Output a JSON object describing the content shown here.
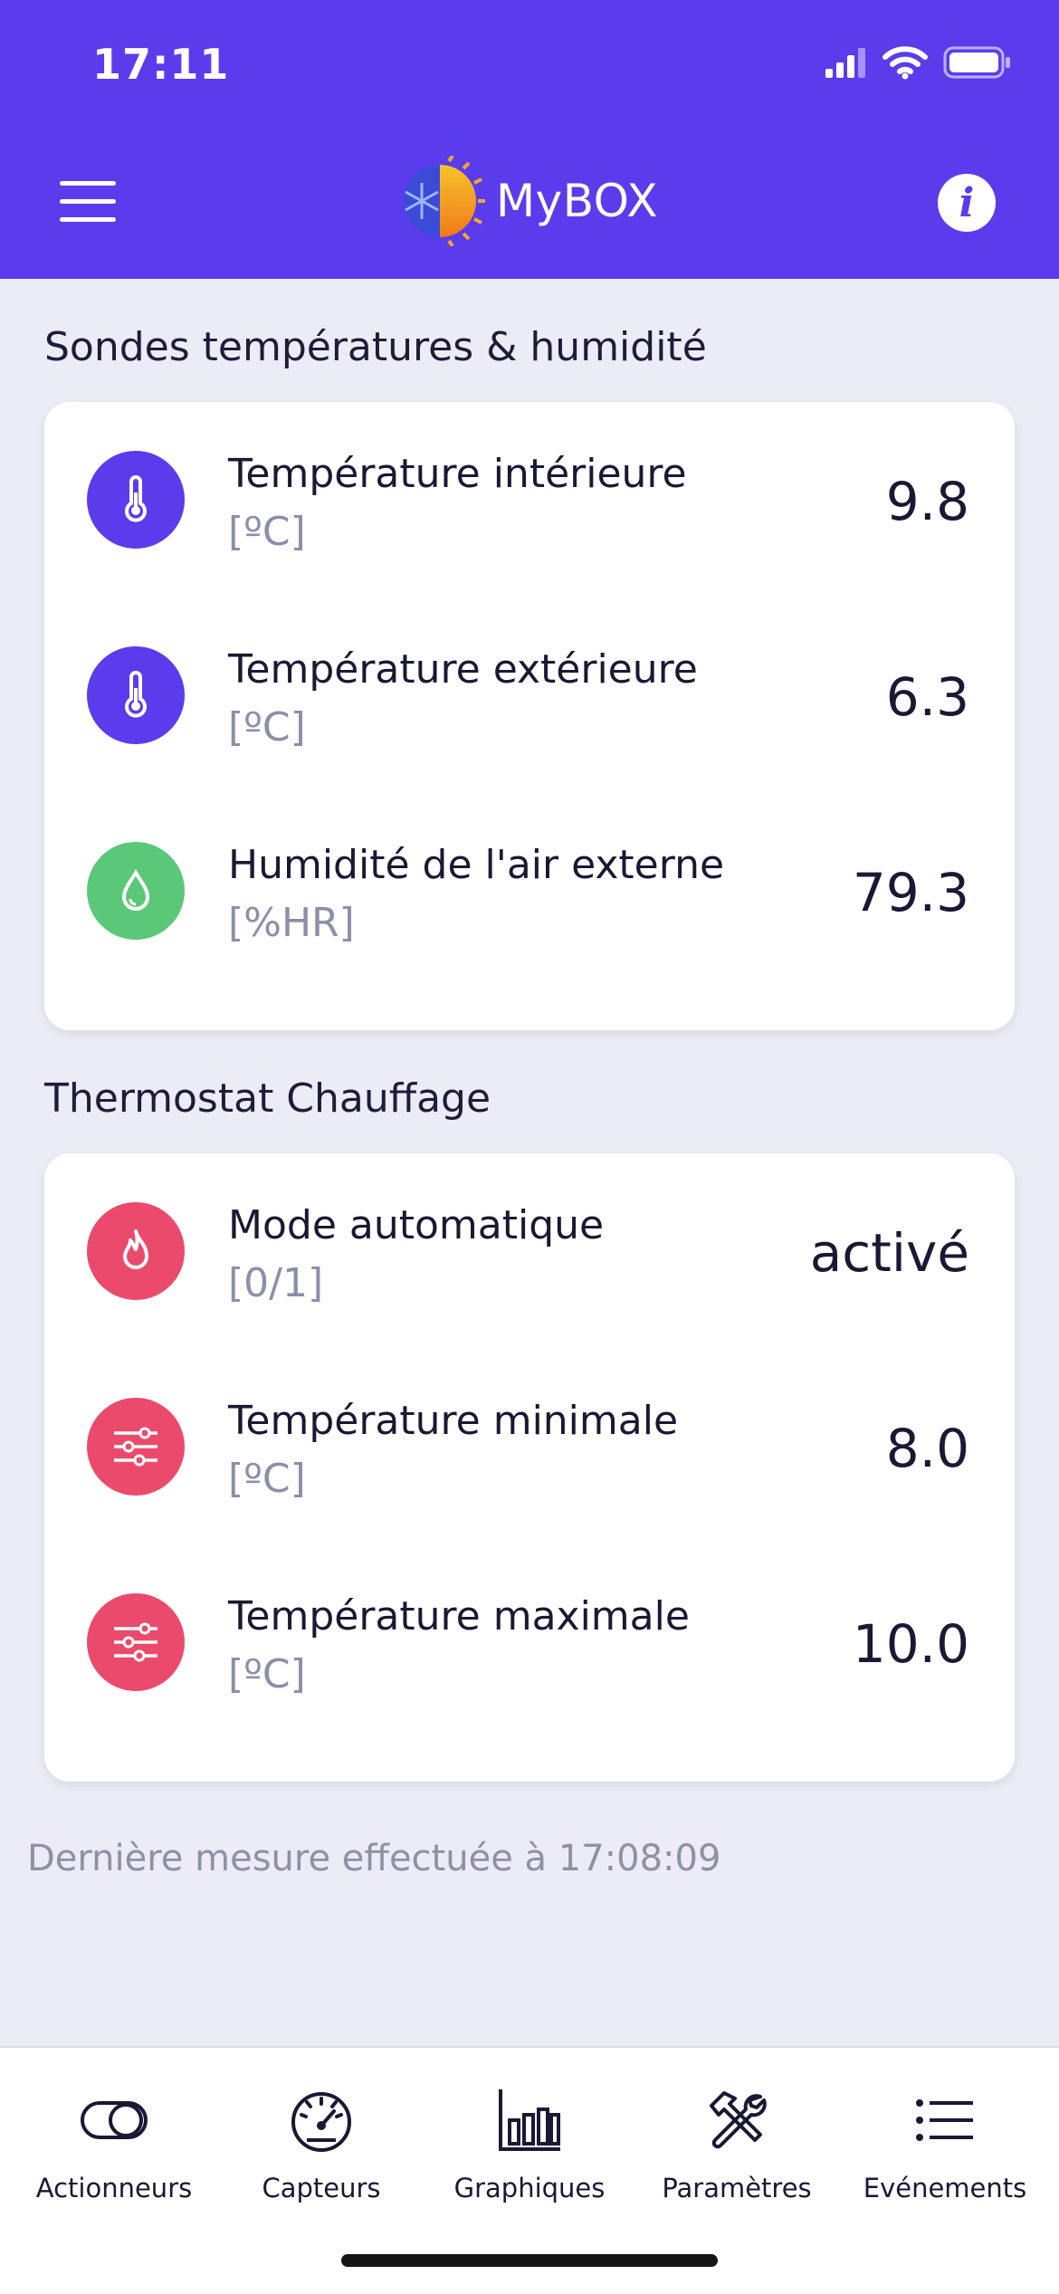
{
  "status_bar": {
    "time": "17:11"
  },
  "header": {
    "title": "MyBOX"
  },
  "sections": [
    {
      "title": "Sondes températures & humidité",
      "rows": [
        {
          "label": "Température intérieure",
          "unit": "[ºC]",
          "value": "9.8",
          "icon": "thermometer-icon",
          "color": "#5a3ced"
        },
        {
          "label": "Température extérieure",
          "unit": "[ºC]",
          "value": "6.3",
          "icon": "thermometer-icon",
          "color": "#5a3ced"
        },
        {
          "label": "Humidité de l'air externe",
          "unit": "[%HR]",
          "value": "79.3",
          "icon": "water-drop-icon",
          "color": "#5ac878"
        }
      ]
    },
    {
      "title": "Thermostat Chauffage",
      "rows": [
        {
          "label": "Mode automatique",
          "unit": "[0/1]",
          "value": "activé",
          "icon": "flame-icon",
          "color": "#ec4a6c"
        },
        {
          "label": "Température minimale",
          "unit": "[ºC]",
          "value": "8.0",
          "icon": "sliders-icon",
          "color": "#ec4a6c"
        },
        {
          "label": "Température maximale",
          "unit": "[ºC]",
          "value": "10.0",
          "icon": "sliders-icon",
          "color": "#ec4a6c"
        }
      ]
    }
  ],
  "footer_note": "Dernière mesure effectuée à 17:08:09",
  "tabs": [
    {
      "label": "Actionneurs",
      "icon": "toggle-icon"
    },
    {
      "label": "Capteurs",
      "icon": "gauge-icon"
    },
    {
      "label": "Graphiques",
      "icon": "bar-chart-icon"
    },
    {
      "label": "Paramètres",
      "icon": "tools-icon"
    },
    {
      "label": "Evénements",
      "icon": "list-icon"
    }
  ],
  "colors": {
    "brand": "#5a3ced",
    "green": "#5ac878",
    "red": "#ec4a6c"
  }
}
